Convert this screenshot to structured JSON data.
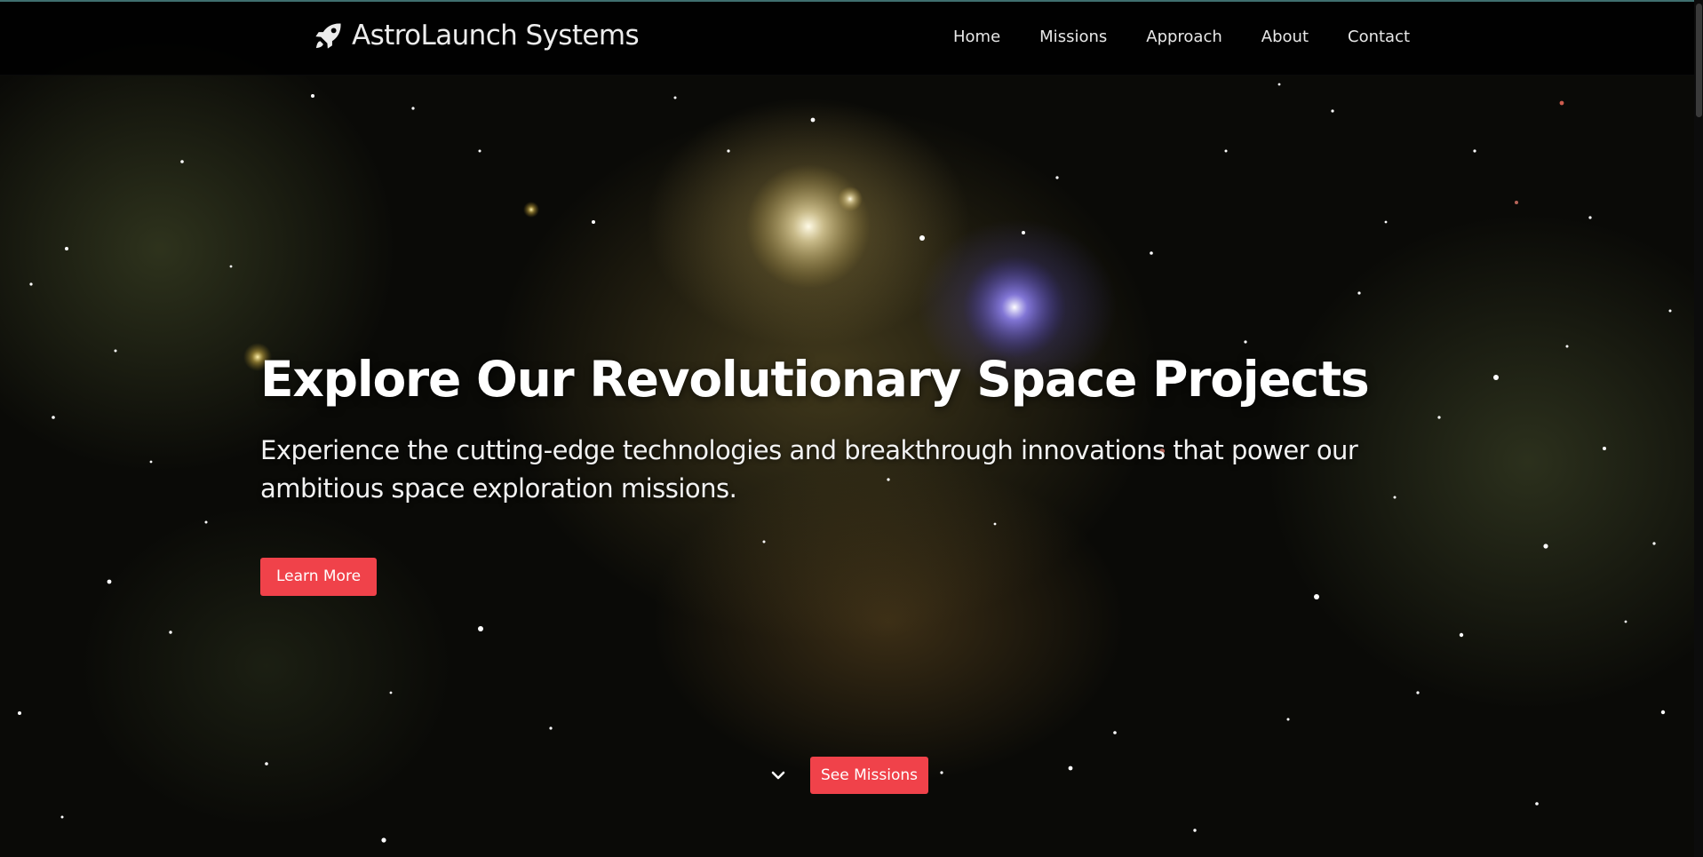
{
  "brand": {
    "name": "AstroLaunch Systems",
    "icon": "rocket-icon"
  },
  "nav": {
    "items": [
      {
        "label": "Home"
      },
      {
        "label": "Missions"
      },
      {
        "label": "Approach"
      },
      {
        "label": "About"
      },
      {
        "label": "Contact"
      }
    ]
  },
  "hero": {
    "title": "Explore Our Revolutionary Space Projects",
    "subtitle": "Experience the cutting-edge technologies and breakthrough innovations that power our ambitious space exploration missions.",
    "cta_label": "Learn More"
  },
  "footer_cta": {
    "icon": "chevron-down-icon",
    "label": "See Missions"
  },
  "colors": {
    "accent": "#f0424a",
    "navbar": "#000000",
    "text": "#ffffff"
  }
}
